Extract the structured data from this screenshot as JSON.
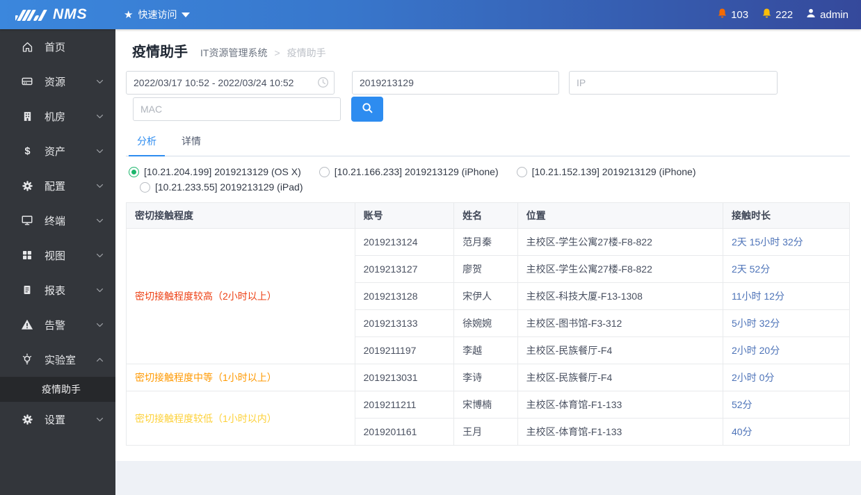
{
  "brand": {
    "name": "NMS"
  },
  "topbar": {
    "quick_access": "快速访问",
    "alerts": [
      {
        "icon": "bell-icon",
        "count": "103",
        "color": "#f56a00"
      },
      {
        "icon": "bell-icon",
        "count": "222",
        "color": "#fbbd08"
      }
    ],
    "user": "admin"
  },
  "sidebar": {
    "items": [
      {
        "key": "home",
        "label": "首页",
        "icon": "home-icon",
        "chevron": null
      },
      {
        "key": "resources",
        "label": "资源",
        "icon": "server-icon",
        "chevron": "down"
      },
      {
        "key": "rooms",
        "label": "机房",
        "icon": "building-icon",
        "chevron": "down"
      },
      {
        "key": "assets",
        "label": "资产",
        "icon": "dollar-icon",
        "chevron": "down"
      },
      {
        "key": "config",
        "label": "配置",
        "icon": "gear-icon",
        "chevron": "down"
      },
      {
        "key": "terminal",
        "label": "终端",
        "icon": "monitor-icon",
        "chevron": "down"
      },
      {
        "key": "views",
        "label": "视图",
        "icon": "grid-icon",
        "chevron": "down"
      },
      {
        "key": "reports",
        "label": "报表",
        "icon": "report-icon",
        "chevron": "down"
      },
      {
        "key": "alerts",
        "label": "告警",
        "icon": "warning-icon",
        "chevron": "down"
      },
      {
        "key": "lab",
        "label": "实验室",
        "icon": "bulb-icon",
        "chevron": "up",
        "children": [
          {
            "key": "epidemic-assistant",
            "label": "疫情助手",
            "active": true
          }
        ]
      },
      {
        "key": "settings",
        "label": "设置",
        "icon": "settings-icon",
        "chevron": "down"
      }
    ]
  },
  "page": {
    "title": "疫情助手",
    "breadcrumb": {
      "root": "IT资源管理系统",
      "separator": ">",
      "current": "疫情助手"
    }
  },
  "filters": {
    "date_range": "2022/03/17 10:52 - 2022/03/24 10:52",
    "account_value": "2019213129",
    "ip_placeholder": "IP",
    "mac_placeholder": "MAC"
  },
  "tabs": [
    {
      "key": "analysis",
      "label": "分析",
      "active": true
    },
    {
      "key": "details",
      "label": "详情",
      "active": false
    }
  ],
  "devices": [
    {
      "label": "[10.21.204.199] 2019213129 (OS X)",
      "selected": true
    },
    {
      "label": "[10.21.166.233] 2019213129 (iPhone)",
      "selected": false
    },
    {
      "label": "[10.21.152.139] 2019213129 (iPhone)",
      "selected": false
    },
    {
      "label": "[10.21.233.55] 2019213129 (iPad)",
      "selected": false
    }
  ],
  "table": {
    "columns": [
      "密切接触程度",
      "账号",
      "姓名",
      "位置",
      "接触时长"
    ],
    "column_widths": [
      "31.6%",
      "13.7%",
      "8.8%",
      "28.4%",
      "17.5%"
    ],
    "groups": [
      {
        "label": "密切接触程度较高（2小时以上）",
        "color": "#ed4014",
        "rows": [
          {
            "account": "2019213124",
            "name": "范月秦",
            "location": "主校区-学生公寓27楼-F8-822",
            "duration": "2天 15小时 32分"
          },
          {
            "account": "2019213127",
            "name": "廖贺",
            "location": "主校区-学生公寓27楼-F8-822",
            "duration": "2天 52分"
          },
          {
            "account": "2019213128",
            "name": "宋伊人",
            "location": "主校区-科技大厦-F13-1308",
            "duration": "11小时 12分"
          },
          {
            "account": "2019213133",
            "name": "徐婉婉",
            "location": "主校区-图书馆-F3-312",
            "duration": "5小时 32分"
          },
          {
            "account": "2019211197",
            "name": "李越",
            "location": "主校区-民族餐厅-F4",
            "duration": "2小时 20分"
          }
        ]
      },
      {
        "label": "密切接触程度中等（1小时以上）",
        "color": "#ff9900",
        "rows": [
          {
            "account": "2019213031",
            "name": "李诗",
            "location": "主校区-民族餐厅-F4",
            "duration": "2小时 0分"
          }
        ]
      },
      {
        "label": "密切接触程度较低（1小时以内）",
        "color": "#fdd13a",
        "rows": [
          {
            "account": "2019211211",
            "name": "宋博楠",
            "location": "主校区-体育馆-F1-133",
            "duration": "52分"
          },
          {
            "account": "2019201161",
            "name": "王月",
            "location": "主校区-体育馆-F1-133",
            "duration": "40分"
          }
        ]
      }
    ]
  },
  "colors": {
    "accent": "#2d8cf0",
    "radio_selected": "#1cb66c",
    "duration_link": "#4d73b8",
    "header_gradient_start": "#3b87dd",
    "header_gradient_end": "#35499b",
    "sidebar_bg": "#33363b"
  }
}
